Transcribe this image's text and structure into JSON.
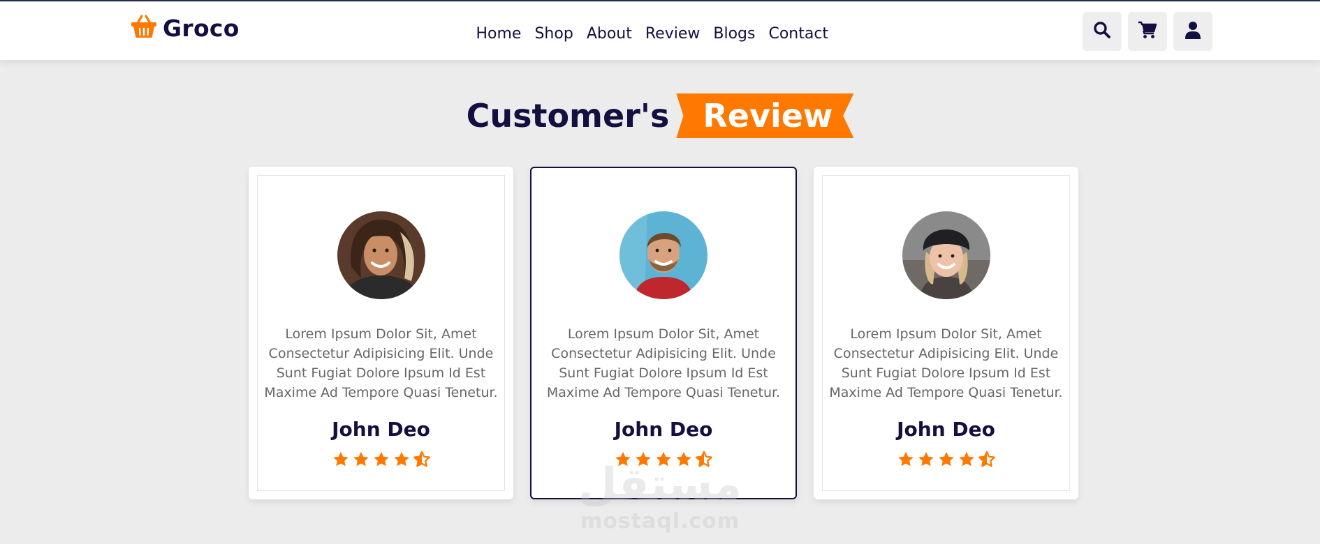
{
  "brand": {
    "name": "Groco",
    "accent": "#ff7800",
    "dark": "#130f40"
  },
  "nav": {
    "items": [
      {
        "label": "Home"
      },
      {
        "label": "Shop"
      },
      {
        "label": "About"
      },
      {
        "label": "Review"
      },
      {
        "label": "Blogs"
      },
      {
        "label": "Contact"
      }
    ]
  },
  "header_icons": [
    "search-icon",
    "cart-icon",
    "user-icon"
  ],
  "section": {
    "heading_main": "Customer's",
    "heading_tag": "Review"
  },
  "reviews": [
    {
      "text": "Lorem Ipsum Dolor Sit, Amet Consectetur Adipisicing Elit. Unde Sunt Fugiat Dolore Ipsum Id Est Maxime Ad Tempore Quasi Tenetur.",
      "name": "John Deo",
      "rating": 4.5,
      "active": false
    },
    {
      "text": "Lorem Ipsum Dolor Sit, Amet Consectetur Adipisicing Elit. Unde Sunt Fugiat Dolore Ipsum Id Est Maxime Ad Tempore Quasi Tenetur.",
      "name": "John Deo",
      "rating": 4.5,
      "active": true
    },
    {
      "text": "Lorem Ipsum Dolor Sit, Amet Consectetur Adipisicing Elit. Unde Sunt Fugiat Dolore Ipsum Id Est Maxime Ad Tempore Quasi Tenetur.",
      "name": "John Deo",
      "rating": 4.5,
      "active": false
    }
  ],
  "watermark": {
    "arabic": "مستقل",
    "latin": "mostaql.com"
  }
}
